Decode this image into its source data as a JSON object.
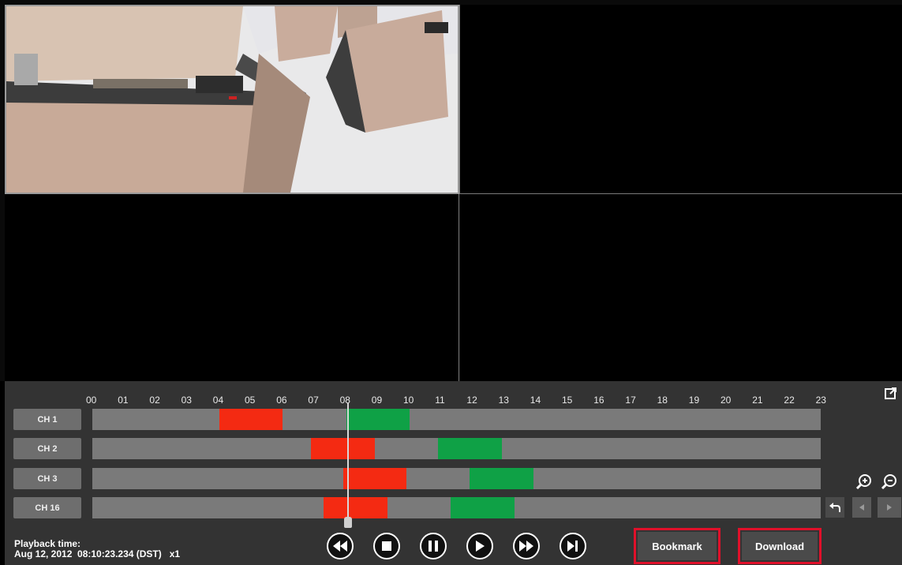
{
  "timeline": {
    "hours": [
      "00",
      "01",
      "02",
      "03",
      "04",
      "05",
      "06",
      "07",
      "08",
      "09",
      "10",
      "11",
      "12",
      "13",
      "14",
      "15",
      "16",
      "17",
      "18",
      "19",
      "20",
      "21",
      "22",
      "23"
    ],
    "channels": [
      {
        "label": "CH 1",
        "segments": [
          {
            "type": "red",
            "start": 4.0,
            "end": 6.0
          },
          {
            "type": "green",
            "start": 8.0,
            "end": 10.0
          }
        ]
      },
      {
        "label": "CH 2",
        "segments": [
          {
            "type": "red",
            "start": 6.9,
            "end": 8.9
          },
          {
            "type": "green",
            "start": 10.9,
            "end": 12.9
          }
        ]
      },
      {
        "label": "CH 3",
        "segments": [
          {
            "type": "red",
            "start": 7.9,
            "end": 9.9
          },
          {
            "type": "green",
            "start": 11.9,
            "end": 13.9
          }
        ]
      },
      {
        "label": "CH 16",
        "segments": [
          {
            "type": "red",
            "start": 7.3,
            "end": 9.3
          },
          {
            "type": "green",
            "start": 11.3,
            "end": 13.3
          }
        ]
      }
    ],
    "playhead_hour": 8.17
  },
  "status": {
    "label": "Playback time:",
    "value": "Aug 12, 2012  08:10:23.234 (DST)   x1"
  },
  "buttons": {
    "bookmark": "Bookmark",
    "download": "Download"
  },
  "colors": {
    "recording_red": "#f42a12",
    "recording_green": "#0fa146",
    "highlight_red": "#e0102a"
  }
}
